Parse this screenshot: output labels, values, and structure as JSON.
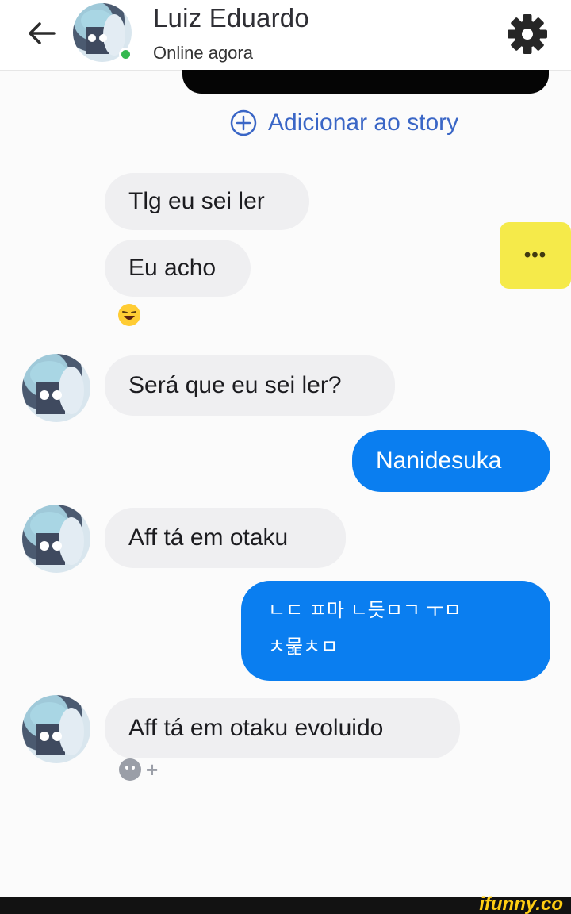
{
  "header": {
    "contact_name": "Luiz Eduardo",
    "status": "Online agora",
    "back_icon": "back-arrow-icon",
    "settings_icon": "gear-icon",
    "online_color": "#34b84f"
  },
  "add_story": {
    "label": "Adicionar ao story",
    "icon": "plus-circle-icon",
    "color": "#3a66c6"
  },
  "messages": [
    {
      "from": "contact",
      "text": "Tlg eu sei ler"
    },
    {
      "from": "contact",
      "text": "Eu acho"
    },
    {
      "from": "contact",
      "text": "Será que eu sei ler?"
    },
    {
      "from": "me",
      "text": "Nanidesuka"
    },
    {
      "from": "contact",
      "text": "Aff tá em otaku"
    },
    {
      "from": "me",
      "text": "ㄴㄷ ㅍ마 ㄴ듯ㅁㄱ ㅜㅁ",
      "text_line2": "ㅊ뭁ㅊㅁ"
    },
    {
      "from": "contact",
      "text": "Aff tá em otaku evoluido"
    }
  ],
  "typing_indicator": {
    "label": "•••",
    "color": "#f5ea4a"
  },
  "reaction": {
    "icon": "add-reaction-icon",
    "plus": "+"
  },
  "colors": {
    "outgoing_bubble": "#0a7ef0",
    "incoming_bubble": "#efeff1"
  },
  "watermark": "ifunny.co"
}
